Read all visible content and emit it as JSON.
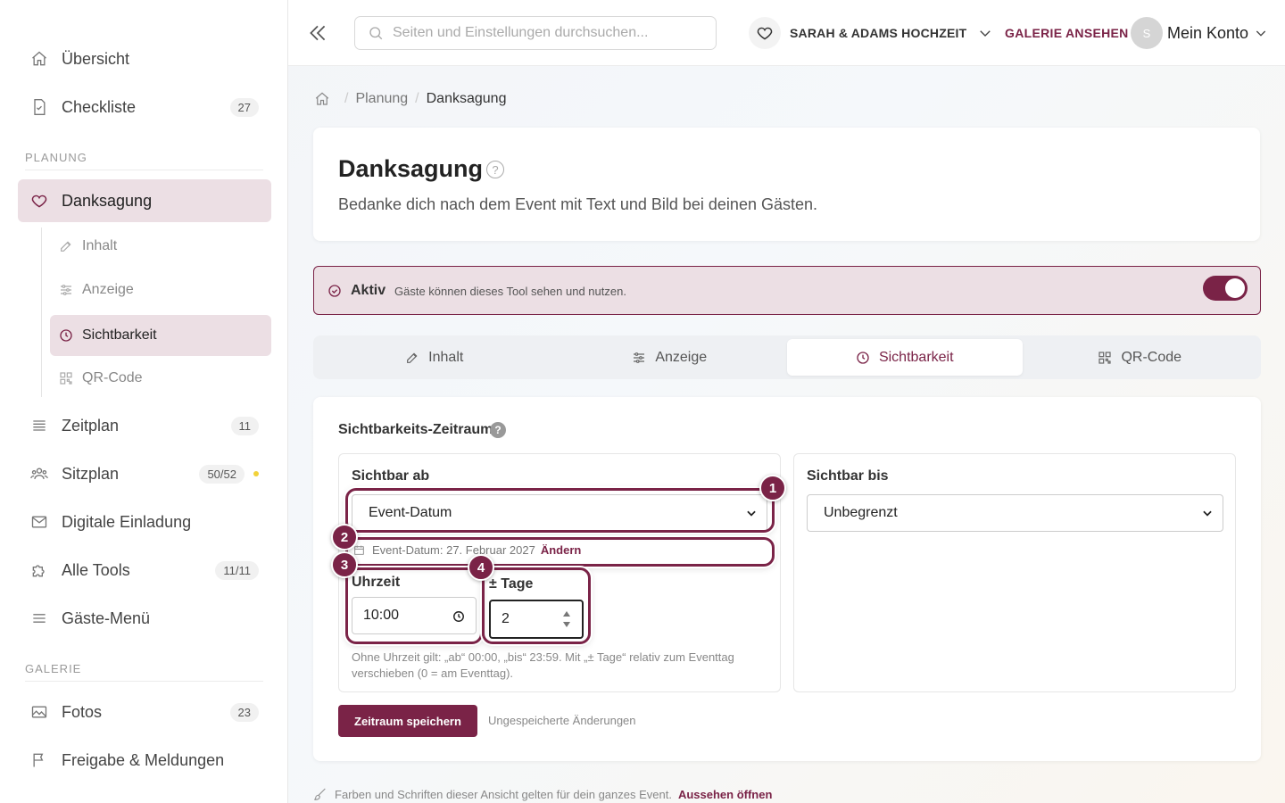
{
  "sidebar": {
    "items": [
      {
        "label": "Übersicht",
        "icon": "home-icon"
      },
      {
        "label": "Checkliste",
        "badge": "27",
        "icon": "checklist-icon"
      }
    ],
    "planning_label": "PLANUNG",
    "active_item": {
      "label": "Danksagung",
      "icon": "heart-icon"
    },
    "sub_items": [
      {
        "label": "Inhalt",
        "icon": "edit-icon"
      },
      {
        "label": "Anzeige",
        "icon": "sliders-icon"
      },
      {
        "label": "Sichtbarkeit",
        "icon": "clock-icon",
        "active": true
      },
      {
        "label": "QR-Code",
        "icon": "qr-code-icon"
      }
    ],
    "more_items": [
      {
        "label": "Zeitplan",
        "badge": "11",
        "icon": "list-icon"
      },
      {
        "label": "Sitzplan",
        "badge": "50/52",
        "icon": "users-icon"
      },
      {
        "label": "Digitale Einladung",
        "icon": "mail-icon"
      },
      {
        "label": "Alle Tools",
        "badge": "11/11",
        "icon": "puzzle-icon"
      },
      {
        "label": "Gäste-Menü",
        "icon": "menu-icon"
      }
    ],
    "gallery_label": "GALERIE",
    "gallery_items": [
      {
        "label": "Fotos",
        "badge": "23",
        "icon": "image-icon"
      },
      {
        "label": "Freigabe & Meldungen",
        "icon": "flag-icon"
      }
    ]
  },
  "topbar": {
    "search_placeholder": "Seiten und Einstellungen durchsuchen...",
    "event_name": "SARAH & ADAMS HOCHZEIT",
    "gallery_link": "GALERIE ANSEHEN",
    "avatar_letter": "S",
    "account_label": "Mein Konto"
  },
  "breadcrumb": {
    "parent": "Planung",
    "current": "Danksagung"
  },
  "header": {
    "title": "Danksagung",
    "help": "?",
    "description": "Bedanke dich nach dem Event mit Text und Bild bei deinen Gästen."
  },
  "status": {
    "title": "Aktiv",
    "description": "Gäste können dieses Tool sehen und nutzen.",
    "enabled": true
  },
  "tabs": [
    {
      "label": "Inhalt",
      "icon": "edit-icon"
    },
    {
      "label": "Anzeige",
      "icon": "sliders-icon"
    },
    {
      "label": "Sichtbarkeit",
      "icon": "clock-icon",
      "active": true
    },
    {
      "label": "QR-Code",
      "icon": "qr-code-icon"
    }
  ],
  "visibility": {
    "section_title": "Sichtbarkeits-Zeitraum",
    "help": "?",
    "from": {
      "title": "Sichtbar ab",
      "select_value": "Event-Datum",
      "event_date_text": "Event-Datum: 27. Februar 2027",
      "change_link": "Ändern",
      "time_label": "Uhrzeit",
      "time_value": "10:00",
      "days_label": "± Tage",
      "days_value": "2",
      "hint": "Ohne Uhrzeit gilt: „ab“ 00:00, „bis“ 23:59. Mit „± Tage“ relativ zum Eventtag verschieben (0 = am Eventtag)."
    },
    "until": {
      "title": "Sichtbar bis",
      "select_value": "Unbegrenzt"
    },
    "save_button": "Zeitraum speichern",
    "unsaved_text": "Ungespeicherte Änderungen"
  },
  "annotations": [
    "1",
    "2",
    "3",
    "4"
  ],
  "footer": {
    "text": "Farben und Schriften dieser Ansicht gelten für dein ganzes Event.",
    "link": "Aussehen öffnen"
  },
  "colors": {
    "accent": "#7a2347",
    "accent_light": "#ecdfe4",
    "badge_dot": "#f2d23a"
  }
}
